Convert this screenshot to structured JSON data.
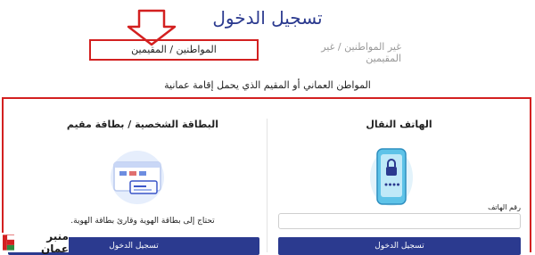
{
  "page": {
    "title": "تسجيل الدخول",
    "subtitle": "المواطن العماني أو المقيم الذي يحمل إقامة عمانية"
  },
  "tabs": [
    {
      "label": "المواطنين / المقيمين",
      "active": true
    },
    {
      "label": "غير المواطنين / غير المقيمين",
      "active": false
    }
  ],
  "id_card": {
    "title": "البطاقة الشخصية / بطاقة مقيم",
    "description": "تحتاج إلى بطاقة الهوية وقارئ بطاقة الهوية.",
    "button_label": "تسجيل الدخول",
    "icon": "id-card-illustration"
  },
  "mobile": {
    "title": "الهاتف النقال",
    "field_label": "رقم الهاتف",
    "field_value": "",
    "button_label": "تسجيل الدخول",
    "icon": "phone-lock-illustration"
  },
  "watermark": {
    "text": "منبر عمان"
  },
  "colors": {
    "brand": "#2b3a8f",
    "annotation": "#d32020",
    "muted": "#9a9a9a"
  }
}
